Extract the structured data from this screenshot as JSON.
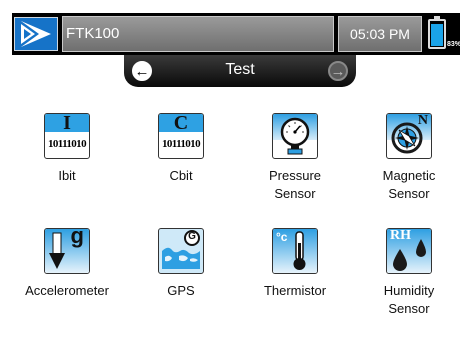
{
  "status_bar": {
    "device_name": "FTK100",
    "time": "05:03 PM",
    "battery_percent": "83%",
    "battery_level": 0.83
  },
  "title_bar": {
    "title": "Test",
    "prev_icon": "arrow-left-icon",
    "next_icon": "arrow-right-icon"
  },
  "apps": [
    {
      "label": "Ibit",
      "icon": "ibit-icon",
      "glyph": "I",
      "bits": "10111010"
    },
    {
      "label": "Cbit",
      "icon": "cbit-icon",
      "glyph": "C",
      "bits": "10111010"
    },
    {
      "label": "Pressure\nSensor",
      "icon": "pressure-gauge-icon"
    },
    {
      "label": "Magnetic\nSensor",
      "icon": "compass-icon",
      "glyph": "N"
    },
    {
      "label": "Accelerometer",
      "icon": "accelerometer-icon",
      "glyph": "g"
    },
    {
      "label": "GPS",
      "icon": "gps-globe-icon",
      "glyph": "G"
    },
    {
      "label": "Thermistor",
      "icon": "thermometer-icon",
      "glyph": "°c"
    },
    {
      "label": "Humidity\nSensor",
      "icon": "humidity-drops-icon",
      "glyph": "RH"
    }
  ],
  "colors": {
    "accent_blue": "#2ea1e3",
    "logo_blue": "#1673c8",
    "bar_gray": "#808080",
    "battery_fill": "#1aa3e8"
  }
}
